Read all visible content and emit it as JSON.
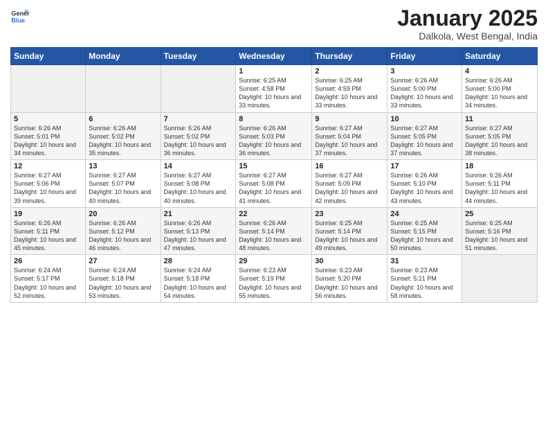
{
  "header": {
    "logo_line1": "General",
    "logo_line2": "Blue",
    "month_title": "January 2025",
    "location": "Dalkola, West Bengal, India"
  },
  "weekdays": [
    "Sunday",
    "Monday",
    "Tuesday",
    "Wednesday",
    "Thursday",
    "Friday",
    "Saturday"
  ],
  "weeks": [
    [
      {
        "day": "",
        "sunrise": "",
        "sunset": "",
        "daylight": ""
      },
      {
        "day": "",
        "sunrise": "",
        "sunset": "",
        "daylight": ""
      },
      {
        "day": "",
        "sunrise": "",
        "sunset": "",
        "daylight": ""
      },
      {
        "day": "1",
        "sunrise": "Sunrise: 6:25 AM",
        "sunset": "Sunset: 4:58 PM",
        "daylight": "Daylight: 10 hours and 33 minutes."
      },
      {
        "day": "2",
        "sunrise": "Sunrise: 6:25 AM",
        "sunset": "Sunset: 4:59 PM",
        "daylight": "Daylight: 10 hours and 33 minutes."
      },
      {
        "day": "3",
        "sunrise": "Sunrise: 6:26 AM",
        "sunset": "Sunset: 5:00 PM",
        "daylight": "Daylight: 10 hours and 33 minutes."
      },
      {
        "day": "4",
        "sunrise": "Sunrise: 6:26 AM",
        "sunset": "Sunset: 5:00 PM",
        "daylight": "Daylight: 10 hours and 34 minutes."
      }
    ],
    [
      {
        "day": "5",
        "sunrise": "Sunrise: 6:26 AM",
        "sunset": "Sunset: 5:01 PM",
        "daylight": "Daylight: 10 hours and 34 minutes."
      },
      {
        "day": "6",
        "sunrise": "Sunrise: 6:26 AM",
        "sunset": "Sunset: 5:02 PM",
        "daylight": "Daylight: 10 hours and 35 minutes."
      },
      {
        "day": "7",
        "sunrise": "Sunrise: 6:26 AM",
        "sunset": "Sunset: 5:02 PM",
        "daylight": "Daylight: 10 hours and 36 minutes."
      },
      {
        "day": "8",
        "sunrise": "Sunrise: 6:26 AM",
        "sunset": "Sunset: 5:03 PM",
        "daylight": "Daylight: 10 hours and 36 minutes."
      },
      {
        "day": "9",
        "sunrise": "Sunrise: 6:27 AM",
        "sunset": "Sunset: 5:04 PM",
        "daylight": "Daylight: 10 hours and 37 minutes."
      },
      {
        "day": "10",
        "sunrise": "Sunrise: 6:27 AM",
        "sunset": "Sunset: 5:05 PM",
        "daylight": "Daylight: 10 hours and 37 minutes."
      },
      {
        "day": "11",
        "sunrise": "Sunrise: 6:27 AM",
        "sunset": "Sunset: 5:05 PM",
        "daylight": "Daylight: 10 hours and 38 minutes."
      }
    ],
    [
      {
        "day": "12",
        "sunrise": "Sunrise: 6:27 AM",
        "sunset": "Sunset: 5:06 PM",
        "daylight": "Daylight: 10 hours and 39 minutes."
      },
      {
        "day": "13",
        "sunrise": "Sunrise: 6:27 AM",
        "sunset": "Sunset: 5:07 PM",
        "daylight": "Daylight: 10 hours and 40 minutes."
      },
      {
        "day": "14",
        "sunrise": "Sunrise: 6:27 AM",
        "sunset": "Sunset: 5:08 PM",
        "daylight": "Daylight: 10 hours and 40 minutes."
      },
      {
        "day": "15",
        "sunrise": "Sunrise: 6:27 AM",
        "sunset": "Sunset: 5:08 PM",
        "daylight": "Daylight: 10 hours and 41 minutes."
      },
      {
        "day": "16",
        "sunrise": "Sunrise: 6:27 AM",
        "sunset": "Sunset: 5:09 PM",
        "daylight": "Daylight: 10 hours and 42 minutes."
      },
      {
        "day": "17",
        "sunrise": "Sunrise: 6:26 AM",
        "sunset": "Sunset: 5:10 PM",
        "daylight": "Daylight: 10 hours and 43 minutes."
      },
      {
        "day": "18",
        "sunrise": "Sunrise: 6:26 AM",
        "sunset": "Sunset: 5:11 PM",
        "daylight": "Daylight: 10 hours and 44 minutes."
      }
    ],
    [
      {
        "day": "19",
        "sunrise": "Sunrise: 6:26 AM",
        "sunset": "Sunset: 5:11 PM",
        "daylight": "Daylight: 10 hours and 45 minutes."
      },
      {
        "day": "20",
        "sunrise": "Sunrise: 6:26 AM",
        "sunset": "Sunset: 5:12 PM",
        "daylight": "Daylight: 10 hours and 46 minutes."
      },
      {
        "day": "21",
        "sunrise": "Sunrise: 6:26 AM",
        "sunset": "Sunset: 5:13 PM",
        "daylight": "Daylight: 10 hours and 47 minutes."
      },
      {
        "day": "22",
        "sunrise": "Sunrise: 6:26 AM",
        "sunset": "Sunset: 5:14 PM",
        "daylight": "Daylight: 10 hours and 48 minutes."
      },
      {
        "day": "23",
        "sunrise": "Sunrise: 6:25 AM",
        "sunset": "Sunset: 5:14 PM",
        "daylight": "Daylight: 10 hours and 49 minutes."
      },
      {
        "day": "24",
        "sunrise": "Sunrise: 6:25 AM",
        "sunset": "Sunset: 5:15 PM",
        "daylight": "Daylight: 10 hours and 50 minutes."
      },
      {
        "day": "25",
        "sunrise": "Sunrise: 6:25 AM",
        "sunset": "Sunset: 5:16 PM",
        "daylight": "Daylight: 10 hours and 51 minutes."
      }
    ],
    [
      {
        "day": "26",
        "sunrise": "Sunrise: 6:24 AM",
        "sunset": "Sunset: 5:17 PM",
        "daylight": "Daylight: 10 hours and 52 minutes."
      },
      {
        "day": "27",
        "sunrise": "Sunrise: 6:24 AM",
        "sunset": "Sunset: 5:18 PM",
        "daylight": "Daylight: 10 hours and 53 minutes."
      },
      {
        "day": "28",
        "sunrise": "Sunrise: 6:24 AM",
        "sunset": "Sunset: 5:18 PM",
        "daylight": "Daylight: 10 hours and 54 minutes."
      },
      {
        "day": "29",
        "sunrise": "Sunrise: 6:23 AM",
        "sunset": "Sunset: 5:19 PM",
        "daylight": "Daylight: 10 hours and 55 minutes."
      },
      {
        "day": "30",
        "sunrise": "Sunrise: 6:23 AM",
        "sunset": "Sunset: 5:20 PM",
        "daylight": "Daylight: 10 hours and 56 minutes."
      },
      {
        "day": "31",
        "sunrise": "Sunrise: 6:23 AM",
        "sunset": "Sunset: 5:21 PM",
        "daylight": "Daylight: 10 hours and 58 minutes."
      },
      {
        "day": "",
        "sunrise": "",
        "sunset": "",
        "daylight": ""
      }
    ]
  ]
}
